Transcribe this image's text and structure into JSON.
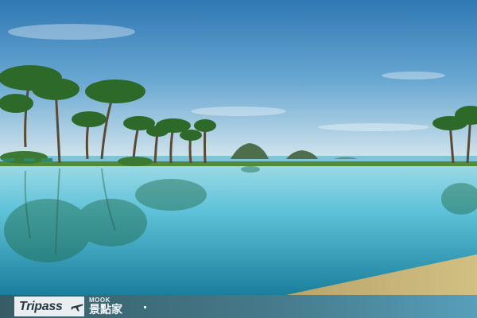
{
  "watermark": {
    "logo": "Tripass",
    "brand_small": "MOOK",
    "brand_big": "景點家"
  },
  "icons": {
    "logo_icon": "airplane-icon"
  },
  "colors": {
    "sky_top": "#2f7fb8",
    "sky_bottom": "#cfe3ec",
    "pool_light": "#6fcbe0",
    "pool_deep": "#1f8aa6",
    "foliage": "#2d6a2a"
  }
}
